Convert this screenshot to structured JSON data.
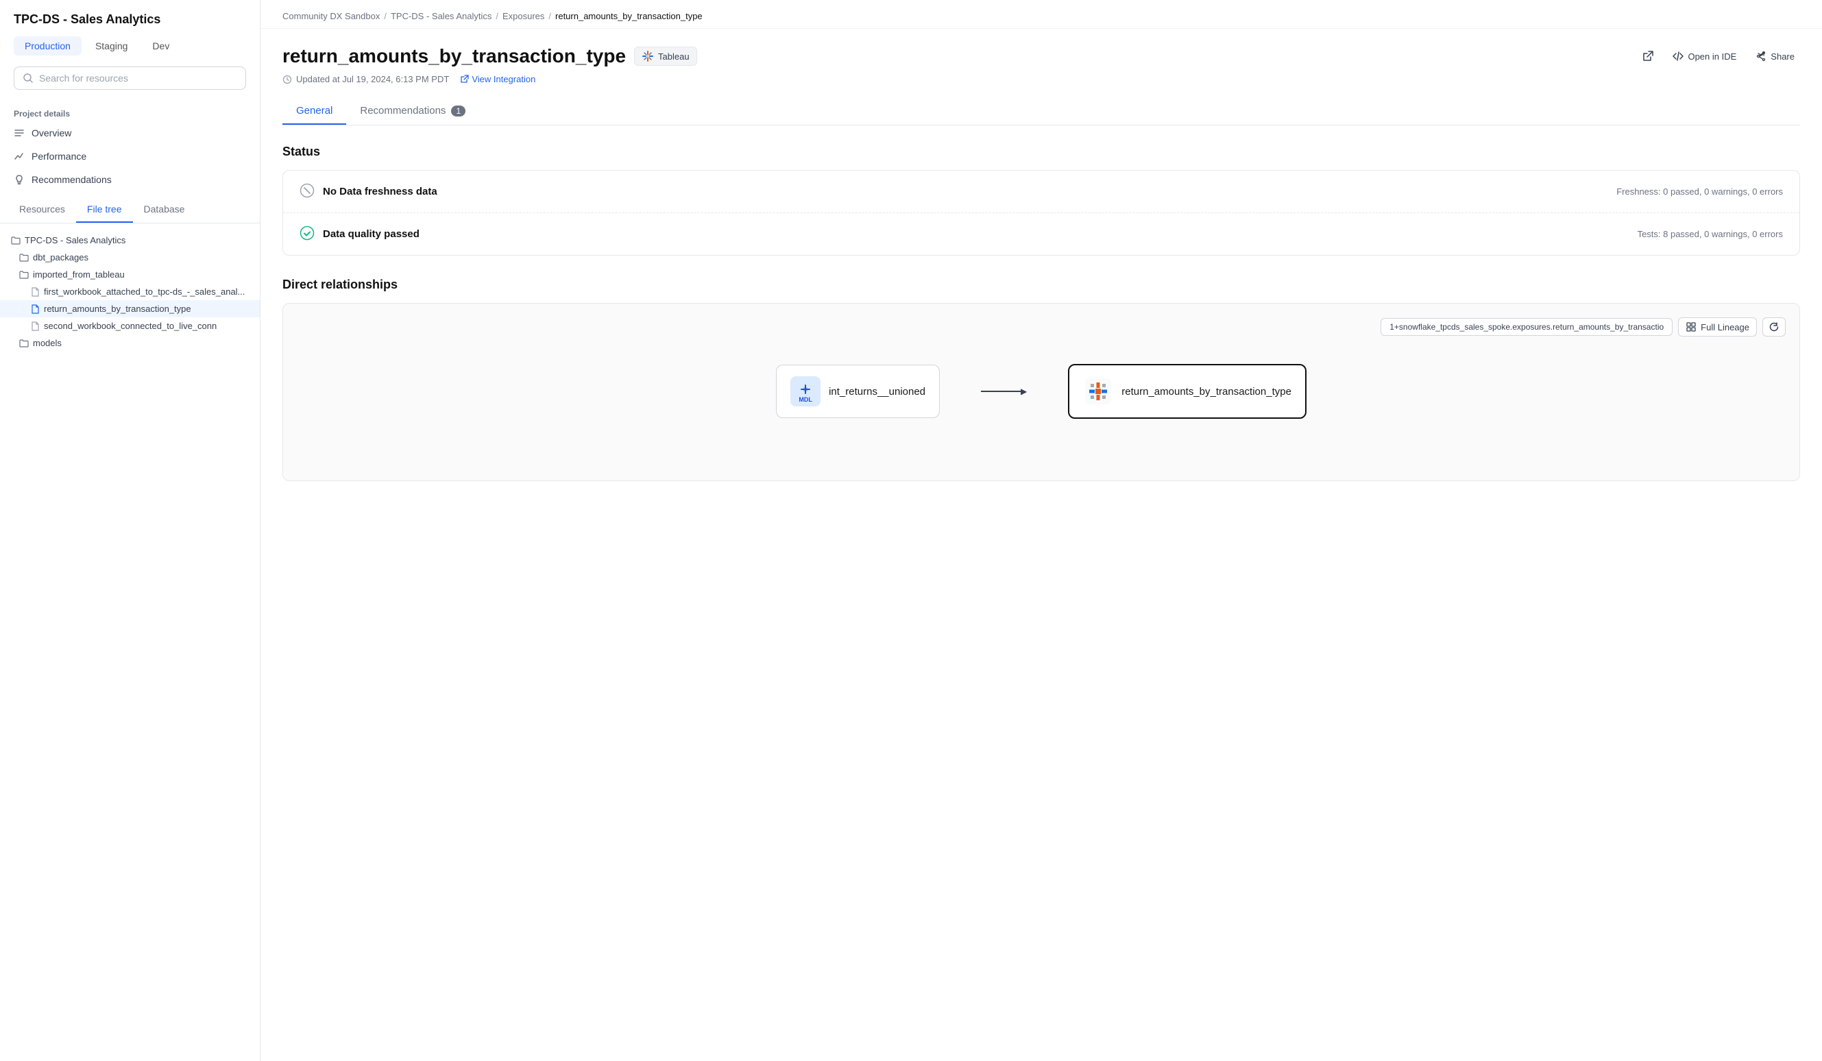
{
  "app": {
    "title": "TPC-DS - Sales Analytics"
  },
  "sidebar": {
    "title": "TPC-DS - Sales Analytics",
    "env_tabs": [
      {
        "label": "Production",
        "active": true
      },
      {
        "label": "Staging",
        "active": false
      },
      {
        "label": "Dev",
        "active": false
      }
    ],
    "search_placeholder": "Search for resources",
    "project_details_label": "Project details",
    "nav_items": [
      {
        "id": "overview",
        "label": "Overview",
        "icon": "list-icon"
      },
      {
        "id": "performance",
        "label": "Performance",
        "icon": "chart-icon"
      },
      {
        "id": "recommendations",
        "label": "Recommendations",
        "icon": "lightbulb-icon"
      }
    ],
    "bottom_tabs": [
      {
        "label": "Resources",
        "active": false
      },
      {
        "label": "File tree",
        "active": true
      },
      {
        "label": "Database",
        "active": false
      }
    ],
    "file_tree": {
      "root": "TPC-DS - Sales Analytics",
      "items": [
        {
          "id": "root",
          "label": "TPC-DS - Sales Analytics",
          "type": "folder",
          "indent": 0
        },
        {
          "id": "dbt_packages",
          "label": "dbt_packages",
          "type": "folder",
          "indent": 1
        },
        {
          "id": "imported_from_tableau",
          "label": "imported_from_tableau",
          "type": "folder",
          "indent": 1
        },
        {
          "id": "file1",
          "label": "first_workbook_attached_to_tpc-ds_-_sales_anal...",
          "type": "file",
          "indent": 2
        },
        {
          "id": "file2",
          "label": "return_amounts_by_transaction_type",
          "type": "file",
          "indent": 2,
          "selected": true
        },
        {
          "id": "file3",
          "label": "second_workbook_connected_to_live_conn",
          "type": "file",
          "indent": 2
        },
        {
          "id": "models",
          "label": "models",
          "type": "folder",
          "indent": 1
        }
      ]
    }
  },
  "breadcrumb": {
    "items": [
      {
        "label": "Community DX Sandbox",
        "link": true
      },
      {
        "label": "TPC-DS - Sales Analytics",
        "link": true
      },
      {
        "label": "Exposures",
        "link": true
      },
      {
        "label": "return_amounts_by_transaction_type",
        "link": false,
        "current": true
      }
    ]
  },
  "page": {
    "title": "return_amounts_by_transaction_type",
    "badge_label": "Tableau",
    "updated_text": "Updated at Jul 19, 2024, 6:13 PM PDT",
    "view_integration_label": "View Integration",
    "actions": {
      "open_external_label": "Open external",
      "open_in_ide_label": "Open in IDE",
      "share_label": "Share"
    },
    "tabs": [
      {
        "label": "General",
        "active": true,
        "badge": null
      },
      {
        "label": "Recommendations",
        "active": false,
        "badge": "1"
      }
    ],
    "status": {
      "section_title": "Status",
      "rows": [
        {
          "icon": "error-circle",
          "label": "No Data freshness data",
          "detail": "Freshness: 0 passed, 0 warnings, 0 errors",
          "icon_color": "#9ca3af"
        },
        {
          "icon": "check-circle",
          "label": "Data quality passed",
          "detail": "Tests: 8 passed, 0 warnings, 0 errors",
          "icon_color": "#10b981"
        }
      ]
    },
    "direct_relationships": {
      "section_title": "Direct relationships",
      "lineage_search_value": "1+snowflake_tpcds_sales_spoke.exposures.return_amounts_by_transactio",
      "full_lineage_label": "Full Lineage",
      "nodes": [
        {
          "id": "node1",
          "label": "int_returns__unioned",
          "icon_type": "mdl",
          "icon_text": "MDL"
        },
        {
          "id": "node2",
          "label": "return_amounts_by_transaction_type",
          "icon_type": "tableau",
          "highlighted": true
        }
      ]
    }
  }
}
